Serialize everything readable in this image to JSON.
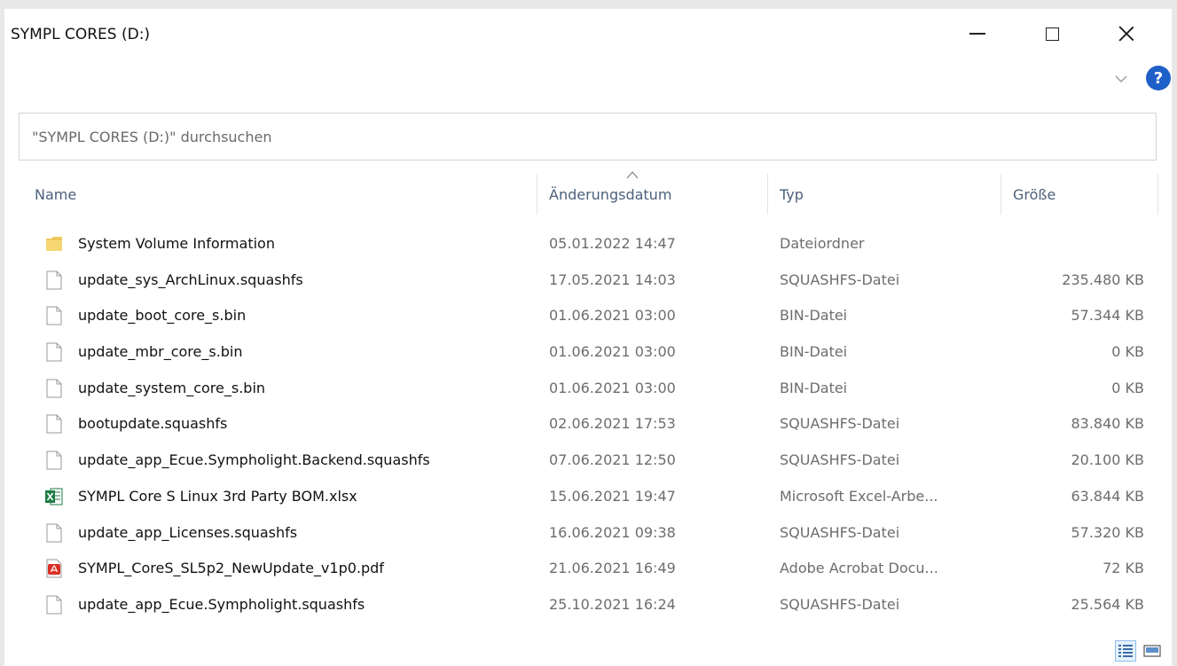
{
  "window": {
    "title": "SYMPL CORES (D:)"
  },
  "search": {
    "placeholder": "\"SYMPL CORES (D:)\" durchsuchen"
  },
  "columns": {
    "name": "Name",
    "date": "Änderungsdatum",
    "type": "Typ",
    "size": "Größe"
  },
  "files": [
    {
      "name": "System Volume Information",
      "date": "05.01.2022 14:47",
      "type": "Dateiordner",
      "size": "",
      "icon": "folder-icon"
    },
    {
      "name": "update_sys_ArchLinux.squashfs",
      "date": "17.05.2021 14:03",
      "type": "SQUASHFS-Datei",
      "size": "235.480 KB",
      "icon": "file-icon"
    },
    {
      "name": "update_boot_core_s.bin",
      "date": "01.06.2021 03:00",
      "type": "BIN-Datei",
      "size": "57.344 KB",
      "icon": "file-icon"
    },
    {
      "name": "update_mbr_core_s.bin",
      "date": "01.06.2021 03:00",
      "type": "BIN-Datei",
      "size": "0 KB",
      "icon": "file-icon"
    },
    {
      "name": "update_system_core_s.bin",
      "date": "01.06.2021 03:00",
      "type": "BIN-Datei",
      "size": "0 KB",
      "icon": "file-icon"
    },
    {
      "name": "bootupdate.squashfs",
      "date": "02.06.2021 17:53",
      "type": "SQUASHFS-Datei",
      "size": "83.840 KB",
      "icon": "file-icon"
    },
    {
      "name": "update_app_Ecue.Sympholight.Backend.squashfs",
      "date": "07.06.2021 12:50",
      "type": "SQUASHFS-Datei",
      "size": "20.100 KB",
      "icon": "file-icon"
    },
    {
      "name": "SYMPL Core S Linux 3rd Party BOM.xlsx",
      "date": "15.06.2021 19:47",
      "type": "Microsoft Excel-Arbe...",
      "size": "63.844 KB",
      "icon": "excel-icon"
    },
    {
      "name": "update_app_Licenses.squashfs",
      "date": "16.06.2021 09:38",
      "type": "SQUASHFS-Datei",
      "size": "57.320 KB",
      "icon": "file-icon"
    },
    {
      "name": "SYMPL_CoreS_SL5p2_NewUpdate_v1p0.pdf",
      "date": "21.06.2021 16:49",
      "type": "Adobe Acrobat Docu...",
      "size": "72 KB",
      "icon": "pdf-icon"
    },
    {
      "name": "update_app_Ecue.Sympholight.squashfs",
      "date": "25.10.2021 16:24",
      "type": "SQUASHFS-Datei",
      "size": "25.564 KB",
      "icon": "file-icon"
    }
  ],
  "colors": {
    "header_text": "#4c607a",
    "help_blue": "#1f5fc8",
    "folder_yellow": "#f0c95a",
    "excel_green": "#1d7a45",
    "pdf_red": "#d93025"
  }
}
